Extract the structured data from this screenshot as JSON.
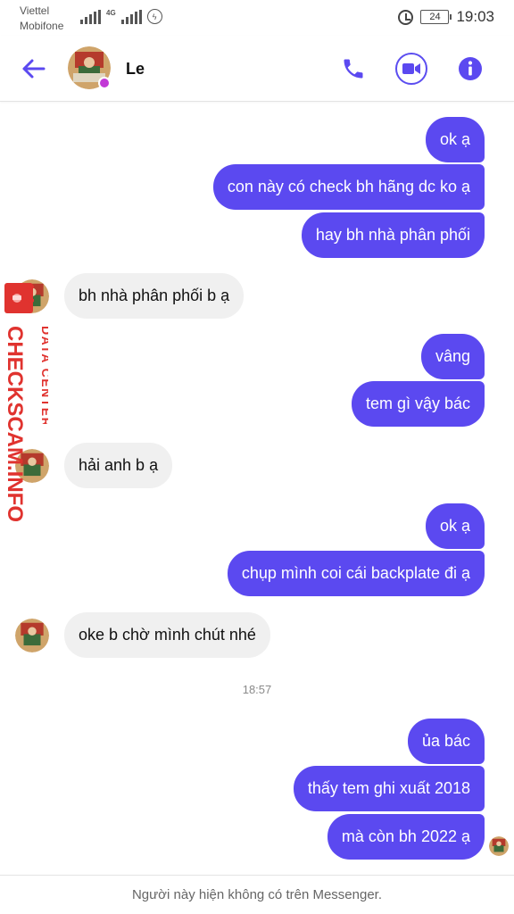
{
  "status_bar": {
    "carrier_1": "Viettel",
    "carrier_2": "Mobifone",
    "network": "4G",
    "battery": "24",
    "time": "19:03"
  },
  "header": {
    "contact_name": "Le",
    "accent_color": "#5b49f0"
  },
  "messages": [
    {
      "side": "out",
      "text": "ok ạ"
    },
    {
      "side": "out",
      "text": "con này có check bh hãng dc ko ạ"
    },
    {
      "side": "out",
      "text": "hay bh nhà phân phối"
    },
    {
      "side": "in",
      "text": "bh nhà phân phối b ạ"
    },
    {
      "side": "out",
      "text": "vâng"
    },
    {
      "side": "out",
      "text": "tem gì vậy bác"
    },
    {
      "side": "in",
      "text": "hải anh b ạ"
    },
    {
      "side": "out",
      "text": "ok ạ"
    },
    {
      "side": "out",
      "text": "chụp mình coi cái backplate đi ạ"
    },
    {
      "side": "in",
      "text": "oke b chờ mình chút nhé"
    },
    {
      "side": "out",
      "text": "ủa bác"
    },
    {
      "side": "out",
      "text": "thấy tem ghi xuất 2018"
    },
    {
      "side": "out",
      "text": "mà còn bh 2022 ạ"
    }
  ],
  "timestamp": "18:57",
  "watermark": {
    "line_1": "DATA CENTER",
    "line_2": "CHECKSCAM.INFO"
  },
  "footer": {
    "notice": "Người này hiện không có trên Messenger."
  }
}
